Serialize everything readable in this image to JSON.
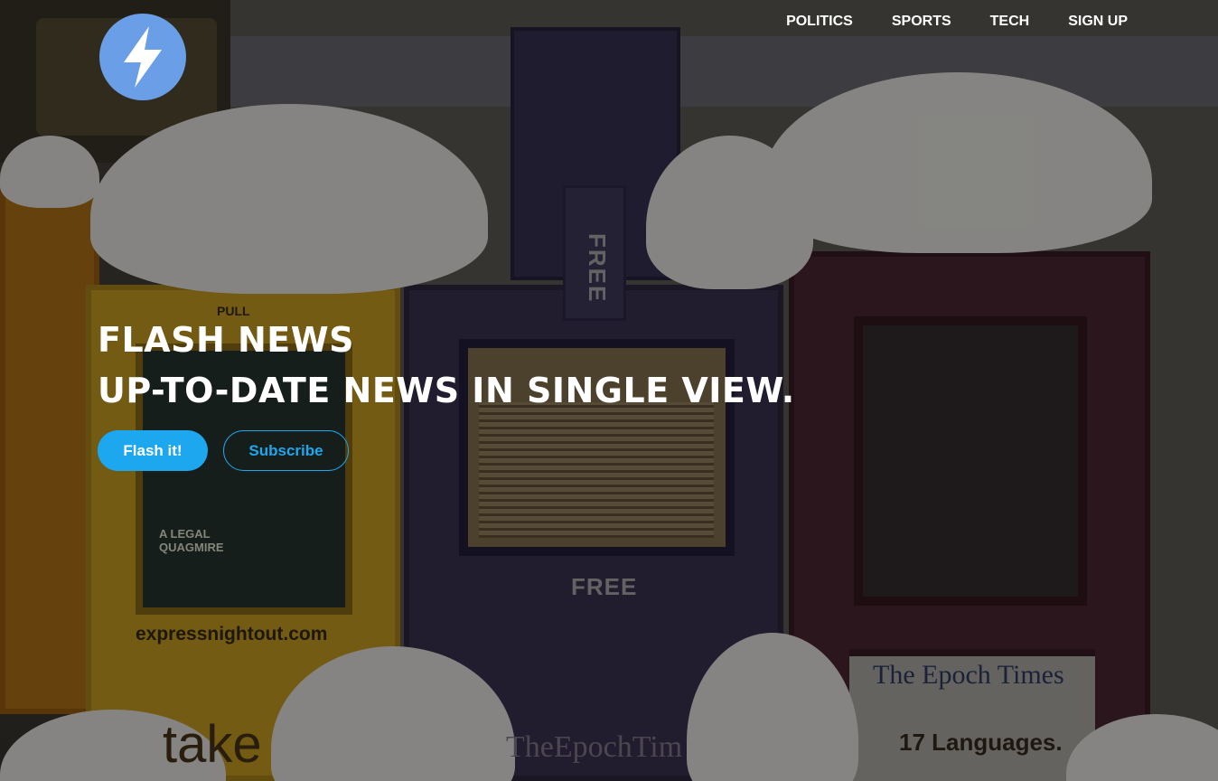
{
  "brand": {
    "logo_icon": "lightning-bolt-icon",
    "accent": "#1da7ee",
    "logo_color": "#6a9ee6"
  },
  "nav": {
    "items": [
      "POLITICS",
      "SPORTS",
      "TECH",
      "SIGN UP"
    ]
  },
  "hero": {
    "title_line1": "FLASH NEWS",
    "title_line2": "UP-TO-DATE NEWS IN SINGLE VIEW.",
    "primary_button": "Flash it!",
    "secondary_button": "Subscribe"
  },
  "background_photo": {
    "pull": "PULL",
    "free_vertical": "FREE",
    "free_horizontal": "FREE",
    "express_url": "expressnightout.com",
    "take": "take",
    "epoch_times": "The Epoch Times",
    "languages": "17 Languages.",
    "epoch_times_lower": "TheEpochTim",
    "legal_quagmire": "A LEGAL\nQUAGMIRE"
  }
}
